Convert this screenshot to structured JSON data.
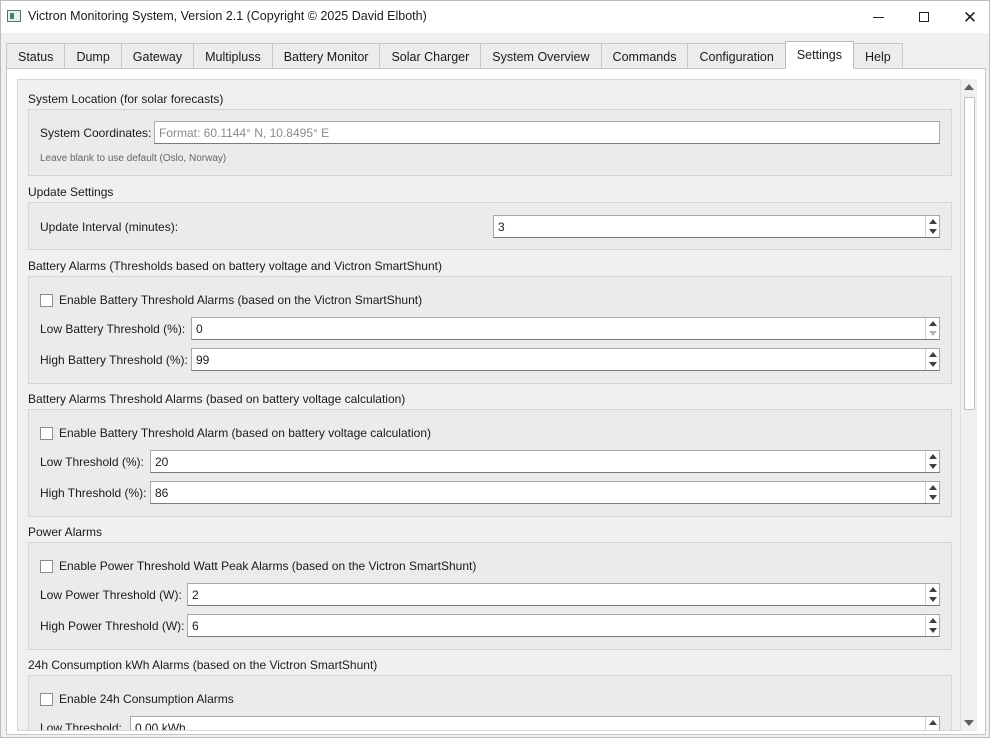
{
  "window": {
    "title": "Victron Monitoring System, Version 2.1 (Copyright © 2025 David Elboth)",
    "controls": {
      "minimize": "minimize",
      "maximize": "maximize",
      "close": "✕"
    }
  },
  "tabs": [
    {
      "label": "Status"
    },
    {
      "label": "Dump"
    },
    {
      "label": "Gateway"
    },
    {
      "label": "Multipluss"
    },
    {
      "label": "Battery Monitor"
    },
    {
      "label": "Solar Charger"
    },
    {
      "label": "System Overview"
    },
    {
      "label": "Commands"
    },
    {
      "label": "Configuration"
    },
    {
      "label": "Settings",
      "active": true
    },
    {
      "label": "Help"
    }
  ],
  "location": {
    "section_title": "System Location (for solar forecasts)",
    "coords_label": "System Coordinates:",
    "coords_value": "",
    "coords_placeholder": "Format: 60.1144° N, 10.8495° E",
    "hint": "Leave blank to use default (Oslo, Norway)"
  },
  "update": {
    "section_title": "Update Settings",
    "interval_label": "Update Interval (minutes):",
    "interval_value": "3"
  },
  "battery_alarms": {
    "section_title": "Battery Alarms (Thresholds based on battery voltage and Victron SmartShunt)",
    "enable_label": "Enable Battery Threshold Alarms (based on the Victron SmartShunt)",
    "enabled": false,
    "low_label": "Low Battery Threshold (%):",
    "low_value": "0",
    "high_label": "High Battery Threshold (%):",
    "high_value": "99"
  },
  "voltage_alarms": {
    "section_title": "Battery Alarms Threshold Alarms (based on battery voltage calculation)",
    "enable_label": "Enable Battery Threshold Alarm (based on battery voltage calculation)",
    "enabled": false,
    "low_label": "Low Threshold (%):",
    "low_value": "20",
    "high_label": "High Threshold (%):",
    "high_value": "86"
  },
  "power_alarms": {
    "section_title": "Power Alarms",
    "enable_label": "Enable Power Threshold Watt Peak Alarms (based on the Victron SmartShunt)",
    "enabled": false,
    "low_label": "Low Power Threshold (W):",
    "low_value": "2",
    "high_label": "High Power Threshold (W):",
    "high_value": "6"
  },
  "consumption_alarms": {
    "section_title": "24h Consumption kWh Alarms (based on the Victron SmartShunt)",
    "enable_label": "Enable 24h Consumption Alarms",
    "enabled": false,
    "low_label": "Low Threshold:",
    "low_value": "0.00 kWh"
  },
  "colors": {
    "background": "#f0f0f0",
    "panel": "#ebebeb",
    "input": "#ffffff",
    "border": "#a9a9a9"
  }
}
